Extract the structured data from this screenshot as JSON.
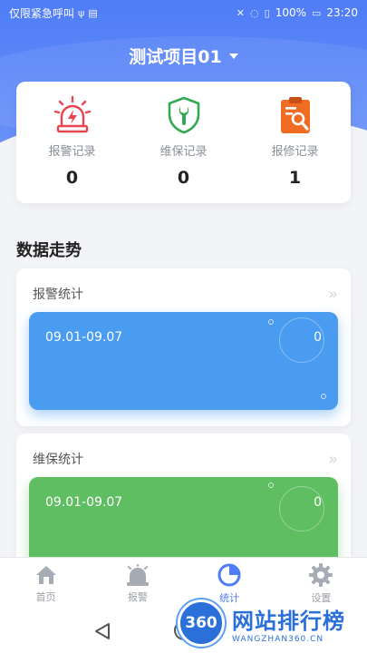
{
  "status_bar": {
    "carrier": "仅限紧急呼叫",
    "battery": "100%",
    "time": "23:20"
  },
  "project": {
    "name": "测试项目01"
  },
  "records": [
    {
      "label": "报警记录",
      "count": "0",
      "icon": "alarm-light-icon",
      "color": "#e9444f"
    },
    {
      "label": "维保记录",
      "count": "0",
      "icon": "shield-wrench-icon",
      "color": "#34a853"
    },
    {
      "label": "报修记录",
      "count": "1",
      "icon": "clipboard-wrench-icon",
      "color": "#ef6c22"
    }
  ],
  "trend": {
    "title": "数据走势",
    "alarm": {
      "title": "报警统计",
      "range": "09.01-09.07",
      "value": "0",
      "color": "#4a9cf0"
    },
    "maintenance": {
      "title": "维保统计",
      "range": "09.01-09.07",
      "value": "0",
      "color": "#5fbd62"
    }
  },
  "tabs": [
    {
      "label": "首页",
      "icon": "home-icon"
    },
    {
      "label": "报警",
      "icon": "alarm-bell-icon"
    },
    {
      "label": "统计",
      "icon": "pie-chart-icon",
      "active": true
    },
    {
      "label": "设置",
      "icon": "gear-icon"
    }
  ],
  "watermark": {
    "logo_text": "360",
    "title": "网站排行榜",
    "subtitle": "WANGZHAN360.CN"
  },
  "colors": {
    "primary": "#4f7df7"
  }
}
